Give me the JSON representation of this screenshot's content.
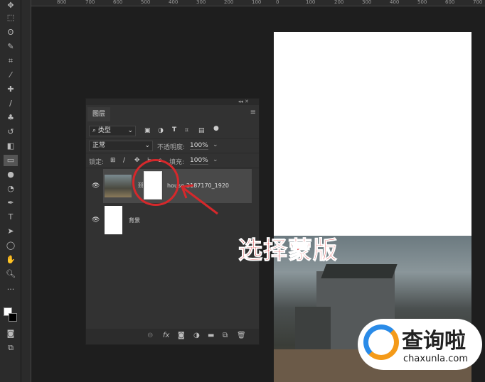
{
  "ruler": {
    "h_labels": [
      "800",
      "700",
      "600",
      "500",
      "400",
      "300",
      "200",
      "100",
      "0",
      "100",
      "200",
      "300",
      "400",
      "500",
      "600",
      "700"
    ]
  },
  "panel": {
    "tab": "图层",
    "filter": "类型",
    "blend_mode": "正常",
    "opacity_label": "不透明度:",
    "opacity": "100%",
    "lock_label": "锁定:",
    "fill_label": "填充:",
    "fill": "100%",
    "layers": [
      {
        "name": "house-2187170_1920",
        "visible": true,
        "selected": true,
        "has_mask": true
      },
      {
        "name": "背景",
        "visible": true,
        "selected": false
      }
    ],
    "bottom_icons": [
      "link-icon",
      "fx-icon",
      "mask-icon",
      "adjustment-icon",
      "folder-icon",
      "new-layer-icon",
      "trash-icon"
    ]
  },
  "annotation": "选择蒙版",
  "watermark": {
    "title": "查询啦",
    "url": "chaxunla.com"
  },
  "colors": {
    "annotation": "#d6282b",
    "watermark_blue": "#2a8be8",
    "watermark_orange": "#f49a19"
  }
}
